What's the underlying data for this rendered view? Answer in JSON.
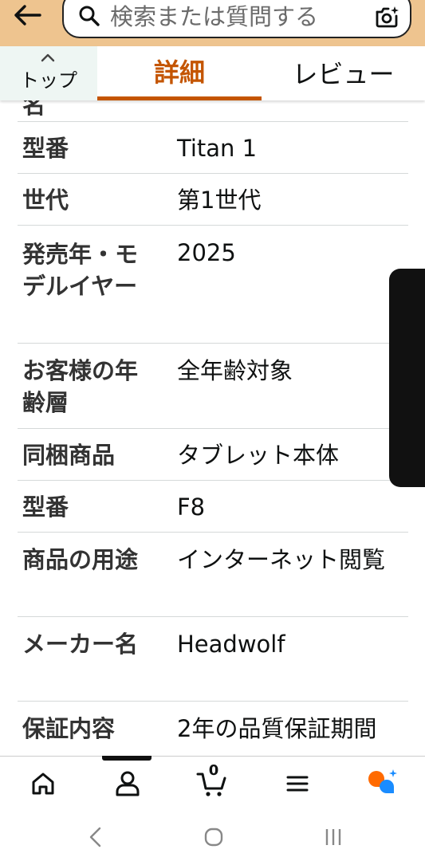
{
  "search": {
    "placeholder": "検索または質問する"
  },
  "tabs": {
    "top_label": "トップ",
    "details_label": "詳細",
    "reviews_label": "レビュー"
  },
  "details": {
    "partial_top": "名",
    "rows": [
      {
        "key": "型番",
        "value": "Titan 1"
      },
      {
        "key": "世代",
        "value": "第1世代"
      },
      {
        "key": "発売年・モデルイヤー",
        "value": "2025"
      },
      {
        "key": "お客様の年齢層",
        "value": "全年齢対象"
      },
      {
        "key": "同梱商品",
        "value": "タブレット本体"
      },
      {
        "key": "型番",
        "value": "F8"
      },
      {
        "key": "商品の用途",
        "value": "インターネット閲覧"
      },
      {
        "key": "メーカー名",
        "value": "Headwolf"
      },
      {
        "key": "保証内容",
        "value": "2年の品質保証期間"
      }
    ]
  },
  "bottom_nav": {
    "cart_count": "0",
    "items": [
      "home-icon",
      "account-icon",
      "cart-icon",
      "menu-icon",
      "assistant-icon"
    ]
  },
  "colors": {
    "header_bg": "#eec48f",
    "accent": "#c45500",
    "top_tab_bg": "#eef6f3",
    "assistant_orange": "#ff6a00",
    "assistant_blue": "#1a8cff"
  }
}
